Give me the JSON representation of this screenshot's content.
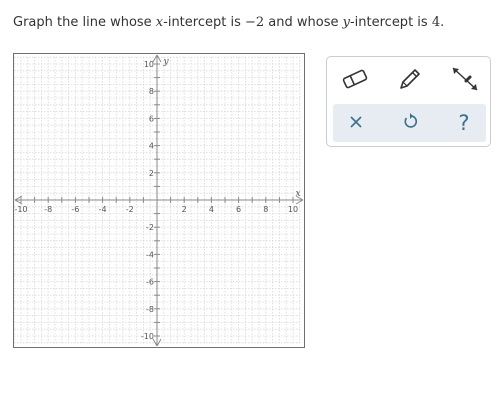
{
  "question": {
    "part1": "Graph the line whose ",
    "var_x": "x",
    "part2": "-intercept is ",
    "x_intercept": "−2",
    "part3": " and whose ",
    "var_y": "y",
    "part4": "-intercept is ",
    "y_intercept": "4",
    "part5": "."
  },
  "graph": {
    "x_axis_label": "x",
    "y_axis_label": "y",
    "x_range": [
      -10,
      10
    ],
    "y_range": [
      -10,
      10
    ],
    "minor_grid_step": 0.5,
    "tick_step": 1,
    "label_step": 2,
    "x_tick_labels": [
      "-10",
      "-8",
      "-6",
      "-4",
      "-2",
      "2",
      "4",
      "6",
      "8",
      "10"
    ],
    "y_tick_labels": [
      "10",
      "8",
      "6",
      "4",
      "2",
      "-2",
      "-4",
      "-6",
      "-8",
      "-10"
    ]
  },
  "toolbox": {
    "tools": [
      {
        "name": "eraser-tool",
        "icon": "eraser-icon"
      },
      {
        "name": "pencil-tool",
        "icon": "pencil-icon"
      },
      {
        "name": "line-tool",
        "icon": "line-segment-icon"
      }
    ],
    "actions": [
      {
        "name": "clear-button",
        "icon": "close-icon",
        "glyph": "✕"
      },
      {
        "name": "undo-button",
        "icon": "undo-icon",
        "glyph": "↺"
      },
      {
        "name": "help-button",
        "icon": "question-icon",
        "glyph": "?"
      }
    ],
    "accent_color": "#3b6e8f",
    "action_bg_color": "#e6ecf1"
  }
}
